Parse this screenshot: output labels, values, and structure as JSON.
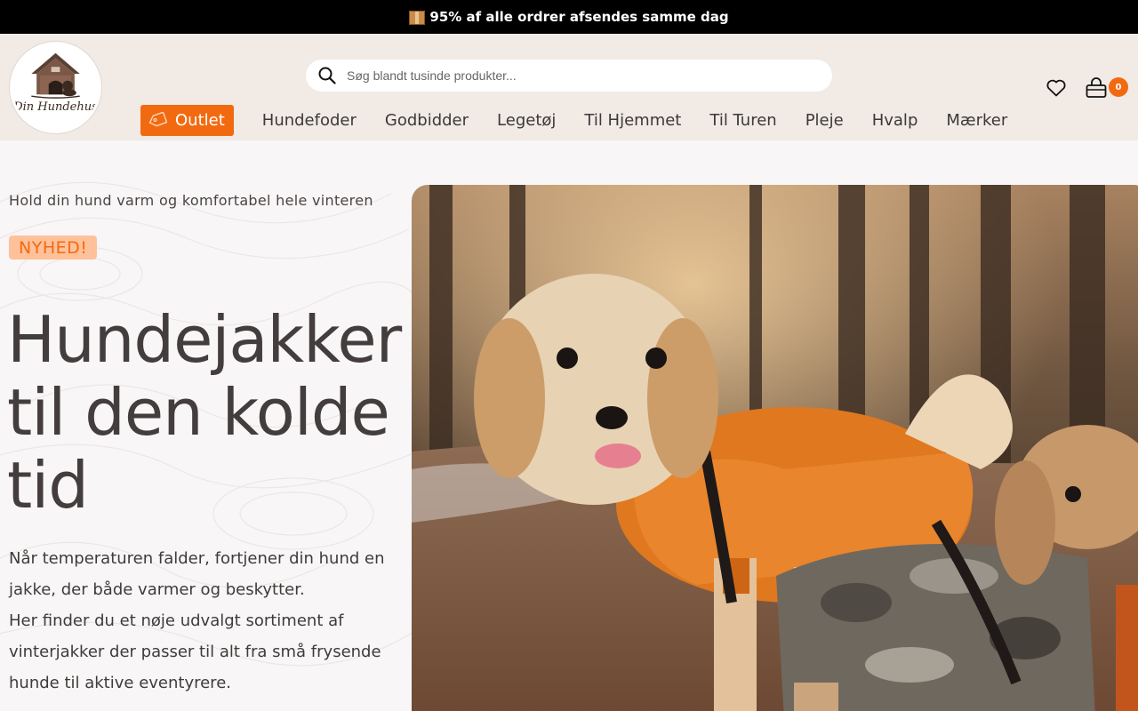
{
  "announcement": {
    "icon": "package-icon",
    "text": "95% af alle ordrer afsendes samme dag"
  },
  "header": {
    "logo": {
      "name": "Hund Hundehus logo",
      "text": "Din Hundehus"
    },
    "search": {
      "placeholder": "Søg blandt tusinde produkter...",
      "value": ""
    },
    "wishlist_icon": "heart-icon",
    "cart": {
      "icon": "basket-icon",
      "count": "0"
    }
  },
  "nav": {
    "outlet": {
      "label": "Outlet",
      "icon": "tag-icon"
    },
    "items": [
      {
        "label": "Hundefoder"
      },
      {
        "label": "Godbidder"
      },
      {
        "label": "Legetøj"
      },
      {
        "label": "Til Hjemmet"
      },
      {
        "label": "Til Turen"
      },
      {
        "label": "Pleje"
      },
      {
        "label": "Hvalp"
      },
      {
        "label": "Mærker"
      }
    ]
  },
  "hero": {
    "tagline": "Hold din hund varm og komfortabel hele vinteren",
    "badge": "NYHED!",
    "headline": "Hundejakker til den kolde tid",
    "description_line1": "Når temperaturen falder, fortjener din hund en jakke, der både varmer og beskytter.",
    "description_line2": "Her finder du et nøje udvalgt sortiment af vinterjakker der passer til alt fra små frysende hunde til aktive eventyrere.",
    "image": "small dog in orange jacket next to toy dog mannequin in camo jacket on forest path",
    "colors": {
      "accent": "#f26a10",
      "badge_bg": "#ffc19a"
    }
  }
}
